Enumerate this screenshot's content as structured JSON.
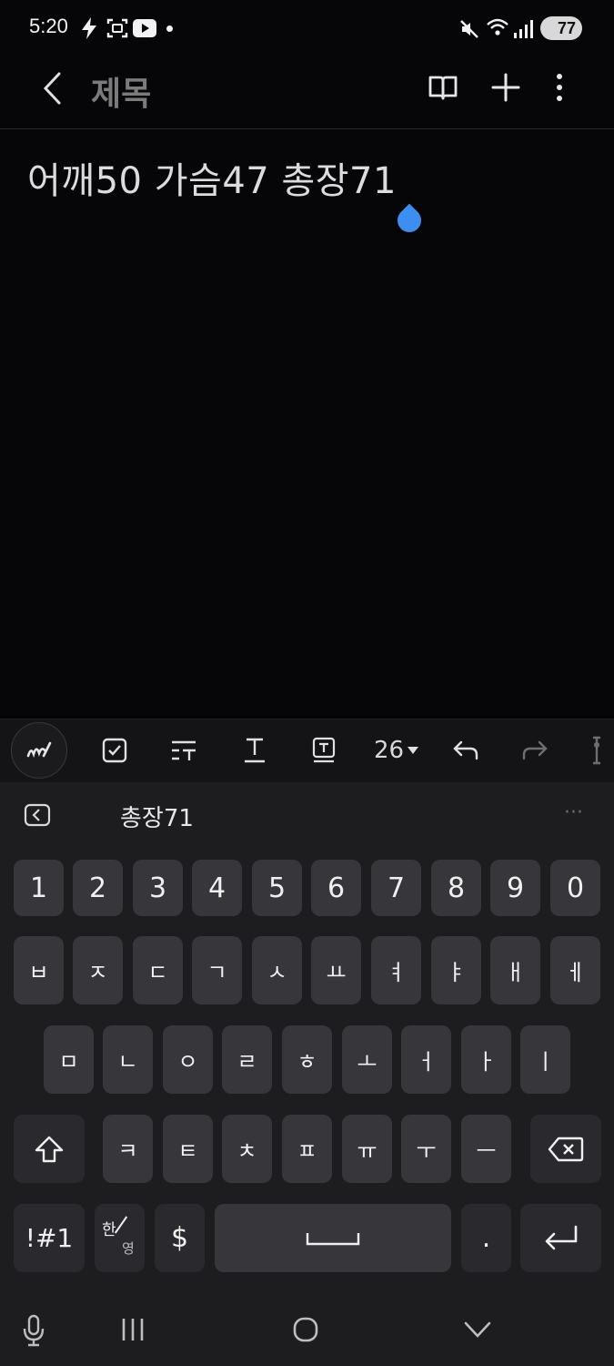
{
  "status_bar": {
    "time": "5:20",
    "battery": "77",
    "icons": [
      "bolt-icon",
      "screen-record-icon",
      "youtube-icon",
      "dot-icon",
      "mute-icon",
      "wifi-icon",
      "signal-icon",
      "battery-icon"
    ]
  },
  "header": {
    "title": "제목",
    "icons": [
      "back-icon",
      "reading-mode-icon",
      "add-icon",
      "more-icon"
    ]
  },
  "note": {
    "text": "어깨50 가슴47 총장71"
  },
  "toolbar": {
    "font_size": "26",
    "items": [
      "pen-icon",
      "checkbox-icon",
      "text-style-icon",
      "text-format-icon",
      "text-box-icon",
      "font-size",
      "undo-icon",
      "redo-icon",
      "cursor-icon"
    ]
  },
  "suggestion": {
    "word": "총장71",
    "more": "···"
  },
  "keyboard": {
    "row_numbers": [
      "1",
      "2",
      "3",
      "4",
      "5",
      "6",
      "7",
      "8",
      "9",
      "0"
    ],
    "row1": [
      "ㅂ",
      "ㅈ",
      "ㄷ",
      "ㄱ",
      "ㅅ",
      "ㅛ",
      "ㅕ",
      "ㅑ",
      "ㅐ",
      "ㅔ"
    ],
    "row2": [
      "ㅁ",
      "ㄴ",
      "ㅇ",
      "ㄹ",
      "ㅎ",
      "ㅗ",
      "ㅓ",
      "ㅏ",
      "ㅣ"
    ],
    "row3": [
      "ㅋ",
      "ㅌ",
      "ㅊ",
      "ㅍ",
      "ㅠ",
      "ㅜ",
      "ㅡ"
    ],
    "symbols_label": "!#1",
    "lang_top": "한",
    "lang_bottom": "영",
    "currency": "$",
    "period": "."
  },
  "colors": {
    "background": "#060608",
    "accent": "#3d8ef0",
    "key": "#37373b",
    "keyboard_bg": "#1d1d20"
  }
}
